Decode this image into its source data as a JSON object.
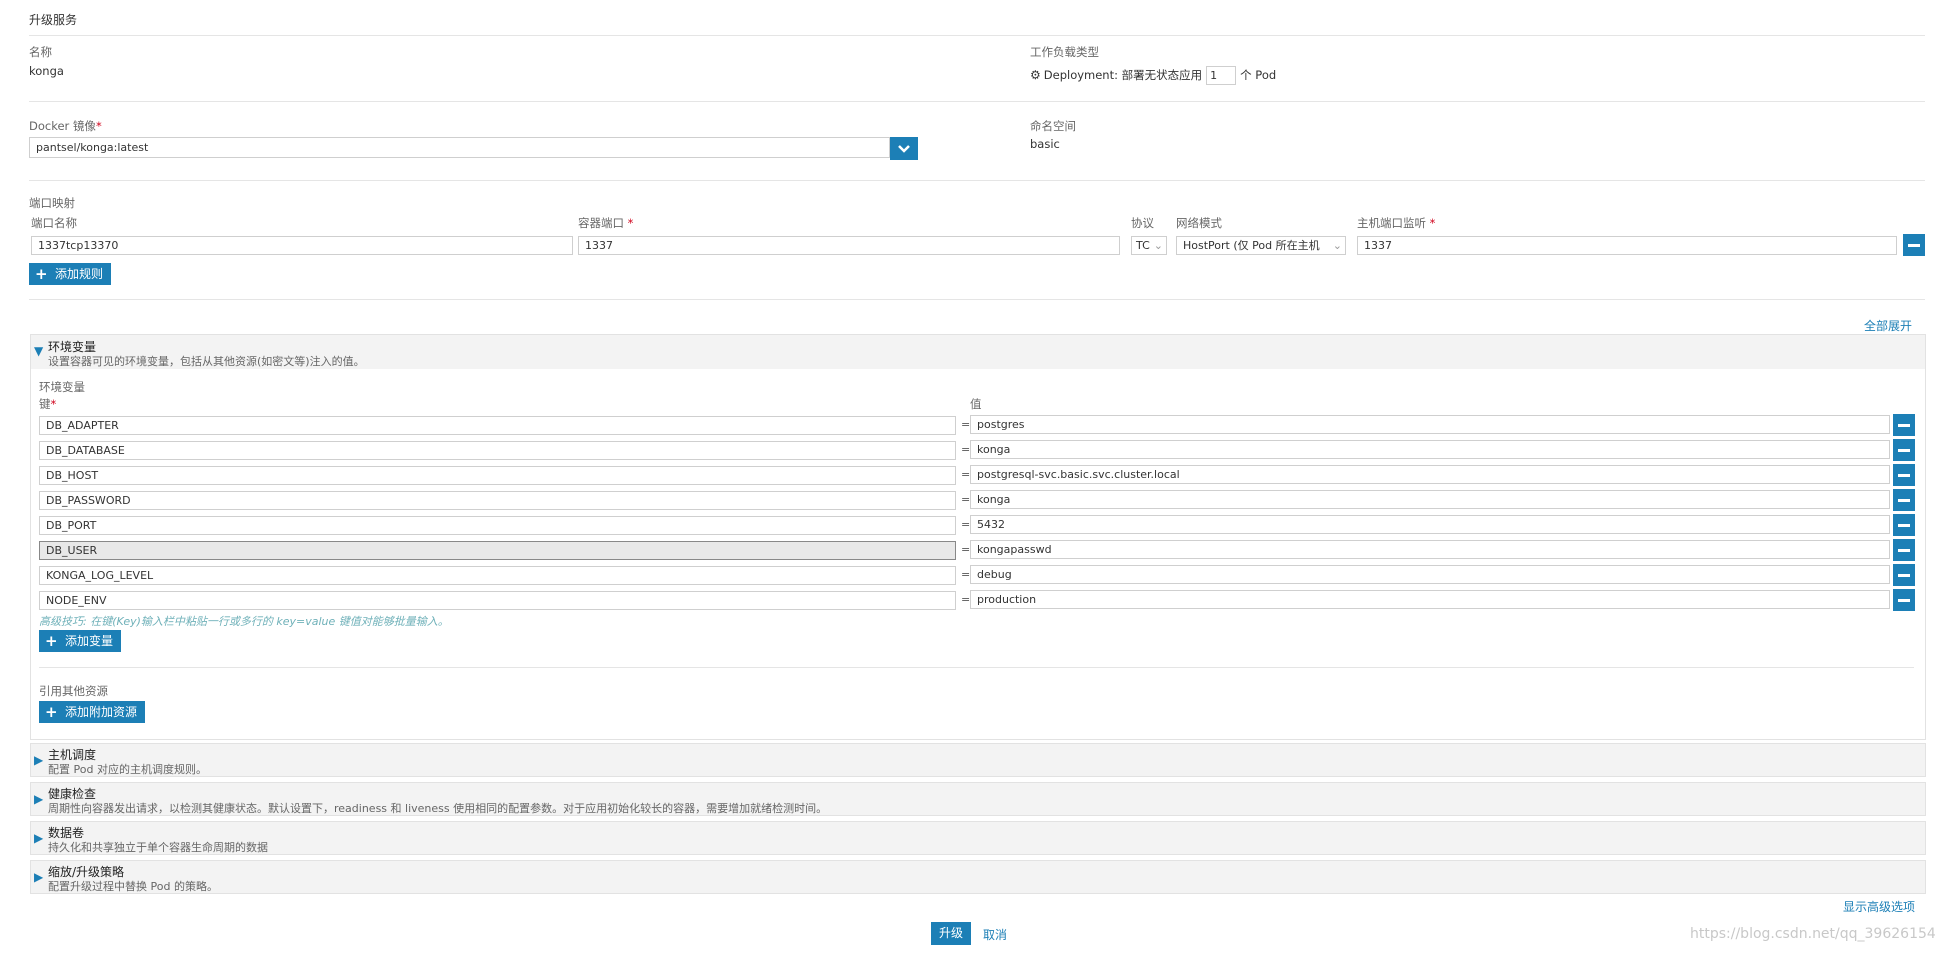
{
  "page_title": "升级服务",
  "name": {
    "label": "名称",
    "value": "konga"
  },
  "workload": {
    "label": "工作负载类型",
    "type_text": "Deployment: 部署无状态应用",
    "replicas": "1",
    "unit": "个 Pod"
  },
  "image": {
    "label": "Docker 镜像",
    "required": "*",
    "value": "pantsel/konga:latest"
  },
  "namespace": {
    "label": "命名空间",
    "value": "basic"
  },
  "ports": {
    "section_label": "端口映射",
    "col_name": "端口名称",
    "col_container_port": "容器端口",
    "col_protocol": "协议",
    "col_network": "网络模式",
    "col_host_port": "主机端口监听",
    "required": "*",
    "row": {
      "name": "1337tcp13370",
      "container_port": "1337",
      "protocol": "TC",
      "network": "HostPort (仅 Pod 所在主机",
      "host_port": "1337"
    },
    "add_label": "添加规则"
  },
  "expand_all": "全部展开",
  "env": {
    "title": "环境变量",
    "desc": "设置容器可见的环境变量，包括从其他资源(如密文等)注入的值。",
    "sub_label": "环境变量",
    "key_label": "键",
    "required": "*",
    "value_label": "值",
    "eq": "=",
    "rows": [
      {
        "key": "DB_ADAPTER",
        "value": "postgres"
      },
      {
        "key": "DB_DATABASE",
        "value": "konga"
      },
      {
        "key": "DB_HOST",
        "value": "postgresql-svc.basic.svc.cluster.local"
      },
      {
        "key": "DB_PASSWORD",
        "value": "konga"
      },
      {
        "key": "DB_PORT",
        "value": "5432"
      },
      {
        "key": "DB_USER",
        "value": "kongapasswd"
      },
      {
        "key": "KONGA_LOG_LEVEL",
        "value": "debug"
      },
      {
        "key": "NODE_ENV",
        "value": "production"
      }
    ],
    "tip": "高级技巧: 在键(Key)输入栏中粘贴一行或多行的 key=value 键值对能够批量输入。",
    "add_var": "添加变量",
    "ref_label": "引用其他资源",
    "add_ref": "添加附加资源"
  },
  "sections": [
    {
      "title": "主机调度",
      "desc": "配置 Pod 对应的主机调度规则。"
    },
    {
      "title": "健康检查",
      "desc": "周期性向容器发出请求，以检测其健康状态。默认设置下，readiness 和 liveness 使用相同的配置参数。对于应用初始化较长的容器，需要增加就绪检测时间。"
    },
    {
      "title": "数据卷",
      "desc": "持久化和共享独立于单个容器生命周期的数据"
    },
    {
      "title": "缩放/升级策略",
      "desc": "配置升级过程中替换 Pod 的策略。"
    }
  ],
  "show_advanced": "显示高级选项",
  "upgrade": "升级",
  "cancel": "取消",
  "watermark": "https://blog.csdn.net/qq_39626154",
  "colors": {
    "accent": "#1c7fb6",
    "panel_bg": "#f3f3f3",
    "required": "#d0021b"
  }
}
